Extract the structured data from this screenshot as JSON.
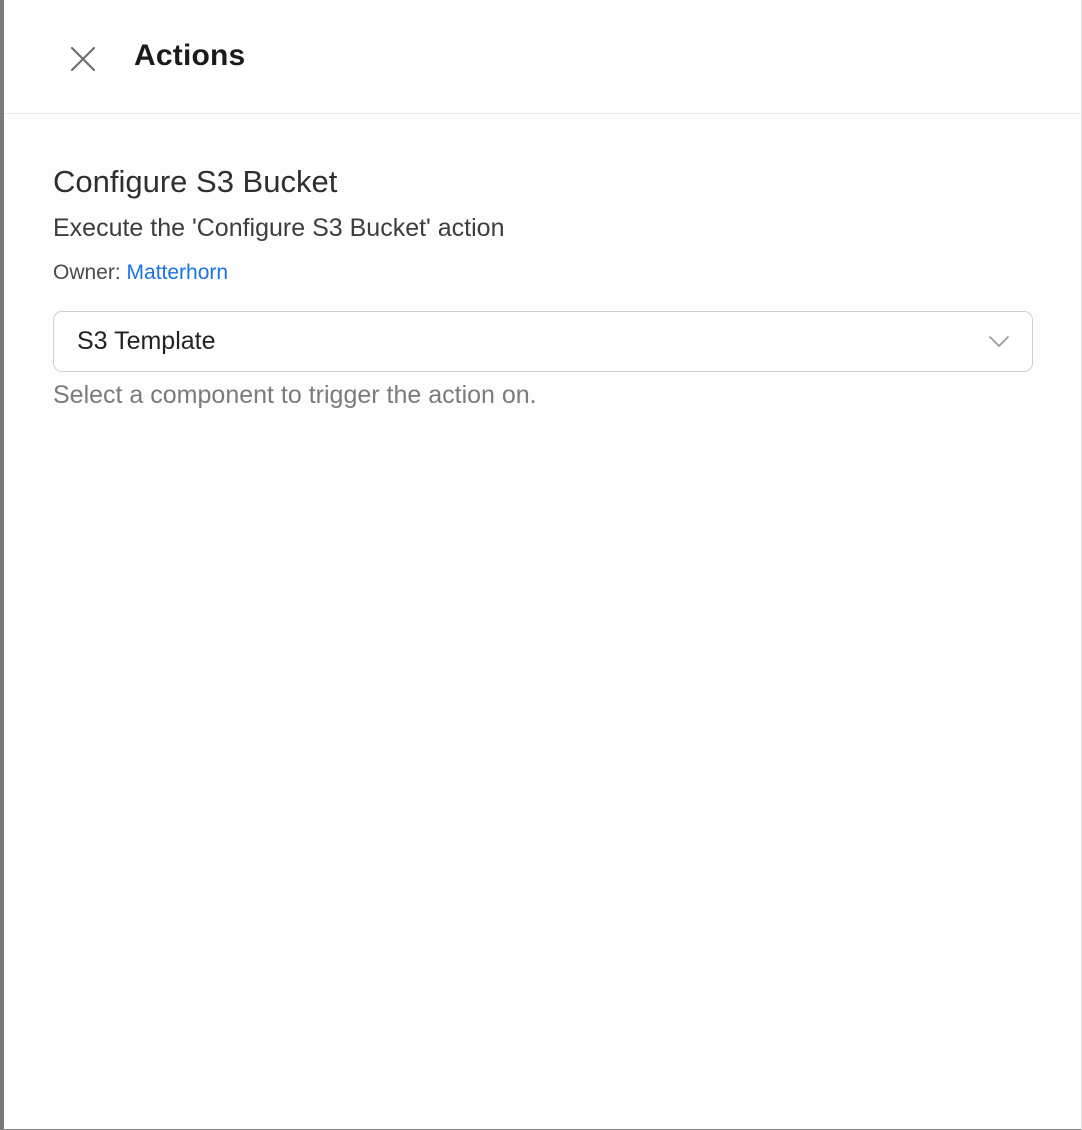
{
  "header": {
    "title": "Actions",
    "close_icon": "close-icon"
  },
  "action": {
    "title": "Configure S3 Bucket",
    "description": "Execute the 'Configure S3 Bucket' action",
    "owner_label": "Owner:",
    "owner_name": "Matterhorn"
  },
  "component_select": {
    "selected_value": "S3 Template",
    "icon": "chevron-down-icon",
    "help_text": "Select a component to trigger the action on."
  },
  "colors": {
    "link": "#1a73e8",
    "title": "#2f2f2f",
    "help_text": "#7b7b7b"
  }
}
